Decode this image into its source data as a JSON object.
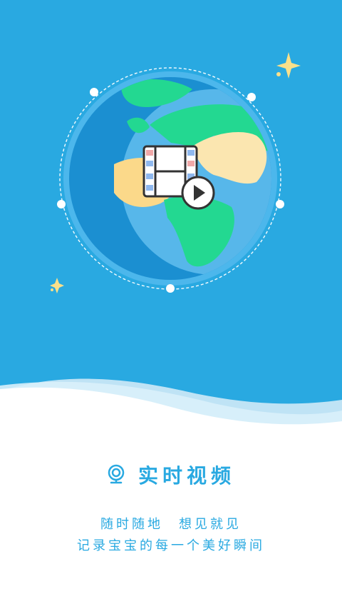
{
  "feature": {
    "icon": "webcam-icon",
    "title": "实时视频"
  },
  "tagline": {
    "part1": "随时随地",
    "part2": "想见就见",
    "line2": "记录宝宝的每一个美好瞬间"
  },
  "colors": {
    "sky": "#29a9e1",
    "ocean_dark": "#1b8fd1",
    "ocean_light": "#57b7ea",
    "land_green": "#23d891",
    "land_sand": "#fbe6b0",
    "wave_light": "#bfe3f5",
    "text_accent": "#29a9e1"
  }
}
